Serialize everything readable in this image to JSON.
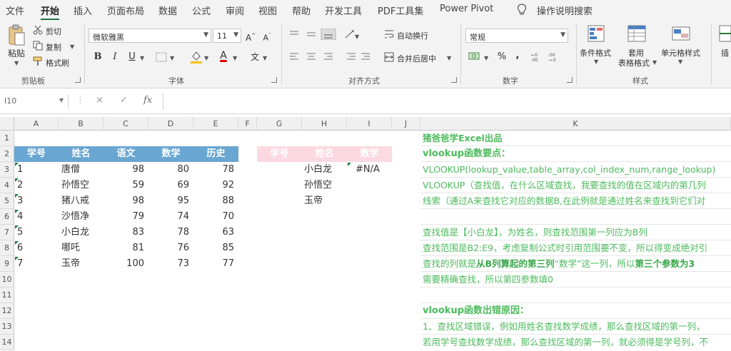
{
  "menu": {
    "tabs": [
      "文件",
      "开始",
      "插入",
      "页面布局",
      "数据",
      "公式",
      "审阅",
      "视图",
      "帮助",
      "开发工具",
      "PDF工具集",
      "Power Pivot"
    ],
    "active": "开始",
    "search_label": "操作说明搜索"
  },
  "ribbon": {
    "clipboard": {
      "paste": "粘贴",
      "cut": "剪切",
      "copy": "复制",
      "format_painter": "格式刷",
      "group": "剪贴板"
    },
    "font": {
      "name": "微软雅黑",
      "size": "11",
      "bold": "B",
      "italic": "I",
      "underline": "U",
      "color_letter": "A",
      "wen": "文",
      "group": "字体"
    },
    "alignment": {
      "wrap": "自动换行",
      "merge": "合并后居中",
      "group": "对齐方式"
    },
    "number": {
      "format": "常规",
      "percent": "%",
      "comma": ",",
      "group": "数字"
    },
    "styles": {
      "conditional": "条件格式",
      "table_line1": "套用",
      "table_line2": "表格格式",
      "cell_style": "单元格样式",
      "group": "样式"
    },
    "insert_partial": "插"
  },
  "formula_bar": {
    "name_box": "I10",
    "fx": "fx",
    "cancel": "×",
    "enter": "✓"
  },
  "grid": {
    "columns": [
      "A",
      "B",
      "C",
      "D",
      "E",
      "F",
      "G",
      "H",
      "I",
      "J",
      "K"
    ],
    "rows": [
      "1",
      "2",
      "3",
      "4",
      "5",
      "6",
      "7",
      "8",
      "9",
      "10",
      "11",
      "12",
      "13",
      "14"
    ],
    "table_headers": [
      "学号",
      "姓名",
      "语文",
      "数学",
      "历史"
    ],
    "table_rows": [
      [
        "1",
        "唐僧",
        "98",
        "80",
        "78"
      ],
      [
        "2",
        "孙悟空",
        "59",
        "69",
        "92"
      ],
      [
        "3",
        "猪八戒",
        "98",
        "95",
        "88"
      ],
      [
        "4",
        "沙悟净",
        "79",
        "74",
        "70"
      ],
      [
        "5",
        "小白龙",
        "83",
        "78",
        "63"
      ],
      [
        "6",
        "哪吒",
        "81",
        "76",
        "85"
      ],
      [
        "7",
        "玉帝",
        "100",
        "73",
        "77"
      ]
    ],
    "lookup_headers": [
      "学号",
      "姓名",
      "数学"
    ],
    "lookup_names": [
      "小白龙",
      "孙悟空",
      "玉帝"
    ],
    "lookup_result": "#N/A",
    "notes": {
      "k1": "猪爸爸学Excel出品",
      "k2": "vlookup函数要点：",
      "k3": "VLOOKUP(lookup_value,table_array,col_index_num,range_lookup)",
      "k4": "VLOOKUP（查找值，在什么区域查找，我要查找的值在区域内的第几列",
      "k5": "线索（通过A来查找它对应的数据B,在此例就是通过姓名来查找到它们对",
      "k7": "查找值是【小白龙】，为姓名，则查找范围第一列应为B列",
      "k8": "查找范围是B2:E9，考虑复制公式时引用范围要不变，所以得变成绝对引",
      "k9a": "查找的列就是",
      "k9b": "从B列算起的第三列",
      "k9c": "“数学”这一列，所以",
      "k9d": "第三个参数为3",
      "k10": "需要精确查找，所以第四参数填0",
      "k12": "vlookup函数出错原因：",
      "k13": "1、查找区域错误，例如用姓名查找数学成绩，那么查找区域的第一列，",
      "k14": "若用学号查找数学成绩，那么查找区域的第一列，就必须得是学号列，不"
    }
  }
}
